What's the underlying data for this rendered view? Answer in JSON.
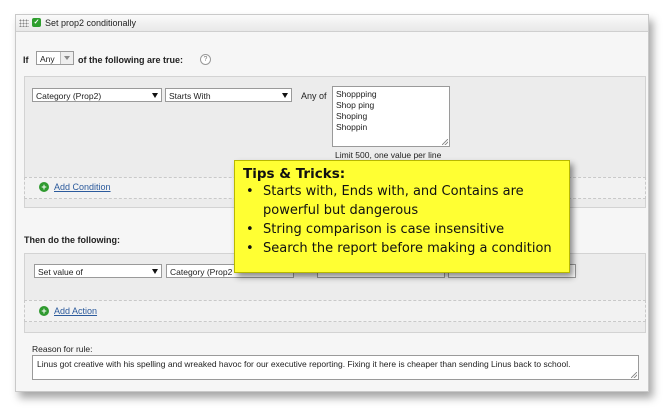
{
  "window": {
    "title": "Set prop2 conditionally"
  },
  "if_row": {
    "prefix": "If",
    "match_mode": "Any",
    "suffix": "of the following are true:"
  },
  "condition": {
    "variable": "Category (Prop2)",
    "operator": "Starts With",
    "any_of_label": "Any of",
    "values": [
      "Shoppping",
      "Shop ping",
      "Shoping",
      "Shoppin"
    ],
    "limit_note": "Limit 500, one value per line",
    "add_condition": "Add Condition"
  },
  "then": {
    "heading": "Then do the following:",
    "action_type": "Set value of",
    "action_target": "Category (Prop2",
    "add_action": "Add Action"
  },
  "reason": {
    "label": "Reason for rule:",
    "text": "Linus got creative with his spelling and wreaked havoc for our executive reporting. Fixing it here is cheaper than sending Linus back to school."
  },
  "tips": {
    "heading": "Tips & Tricks:",
    "items": [
      "Starts with, Ends with, and Contains are powerful but dangerous",
      "String comparison is case insensitive",
      "Search the report before making a condition"
    ]
  },
  "icons": {
    "grip": "drag-grip-icon",
    "rule": "rule-icon",
    "help": "help-icon",
    "add": "plus-circle-icon"
  },
  "colors": {
    "accent_green": "#2f9a2f",
    "link": "#2b5a9c",
    "tip_background": "#ffff33"
  }
}
